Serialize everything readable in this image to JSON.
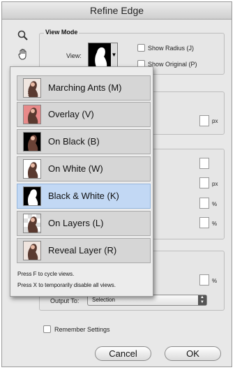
{
  "window": {
    "title": "Refine Edge"
  },
  "tools": {
    "zoom_icon": "magnifier-icon",
    "hand_icon": "hand-icon"
  },
  "view_mode": {
    "title": "View Mode",
    "view_label": "View:",
    "show_radius": "Show Radius (J)",
    "show_original": "Show Original (P)"
  },
  "units": {
    "px1": "px",
    "px2": "px",
    "pct1": "%",
    "pct2": "%",
    "pct3": "%"
  },
  "output": {
    "label": "Output To:",
    "value": "Selection"
  },
  "remember": "Remember Settings",
  "buttons": {
    "cancel": "Cancel",
    "ok": "OK"
  },
  "menu": {
    "items": [
      {
        "label": "Marching Ants (M)",
        "thumb": "marching-ants"
      },
      {
        "label": "Overlay (V)",
        "thumb": "overlay"
      },
      {
        "label": "On Black (B)",
        "thumb": "on-black"
      },
      {
        "label": "On White (W)",
        "thumb": "on-white"
      },
      {
        "label": "Black & White (K)",
        "thumb": "black-white"
      },
      {
        "label": "On Layers (L)",
        "thumb": "on-layers"
      },
      {
        "label": "Reveal Layer (R)",
        "thumb": "reveal-layer"
      }
    ],
    "selected": "Black & White (K)",
    "hint1": "Press F to cycle views.",
    "hint2": "Press X to temporarily disable all views."
  },
  "colors": {
    "selected_row": "#c2d8f4",
    "row_bg": "#d6d6d6"
  }
}
